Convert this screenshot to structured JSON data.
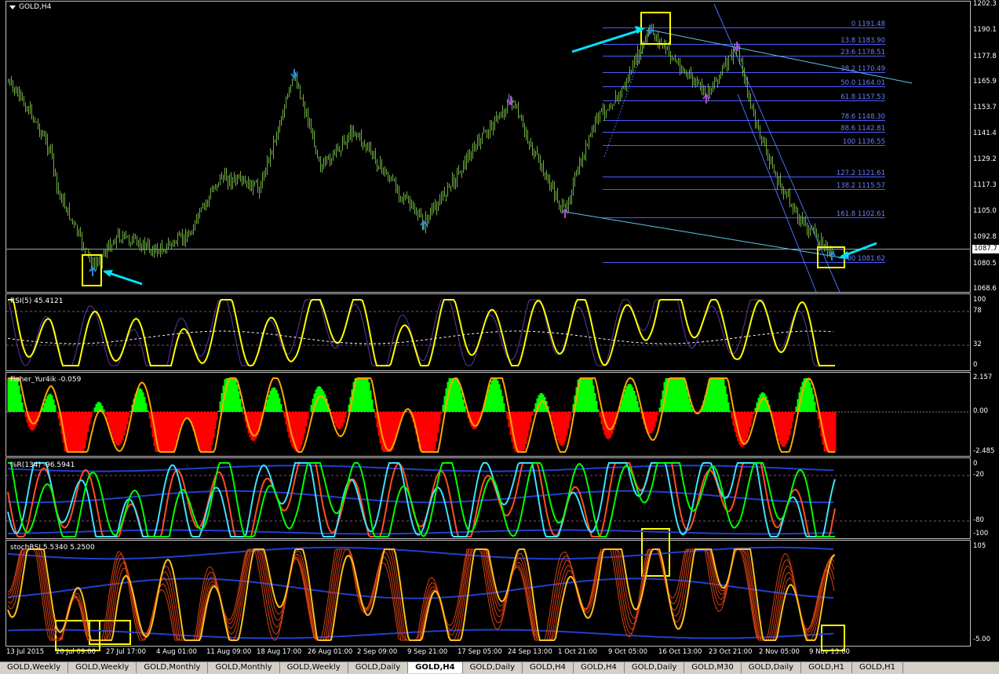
{
  "main_pane": {
    "symbol_label": "GOLD,H4",
    "current_price": "1087.7"
  },
  "price_axis": [
    "1202.3",
    "1190.1",
    "1177.8",
    "1165.9",
    "1153.7",
    "1141.4",
    "1129.2",
    "1117.3",
    "1105.0",
    "1092.8",
    "1080.5",
    "1068.6"
  ],
  "fib_levels": [
    "0 1191.48",
    "13.8 1183.90",
    "23.6 1178.51",
    "38.2 1170.49",
    "50.0 1164.01",
    "61.8 1157.53",
    "78.6 1148.30",
    "88.6 1142.81",
    "100 1136.55",
    "127.2 1121.61",
    "138.2 1115.57",
    "161.8 1102.61",
    "200 1081.62"
  ],
  "indicators": {
    "rsi": {
      "label": "RSI(5) 45.4121",
      "scale": [
        "100",
        "78",
        "32",
        "0"
      ]
    },
    "fisher": {
      "label": "Fisher_Yur4ik -0.059",
      "scale": [
        "2.157",
        "0.00",
        "-2.485"
      ]
    },
    "wpr": {
      "label": "%R(134) -96.5941",
      "scale": [
        "0",
        "-20",
        "-80",
        "-100"
      ]
    },
    "stochrsi": {
      "label": "stochRSI 5.5340 5.2500",
      "scale": [
        "105",
        "-5.00"
      ]
    }
  },
  "date_axis": [
    "13 Jul 2015",
    "20 Jul 09:00",
    "27 Jul 17:00",
    "4 Aug 01:00",
    "11 Aug 09:00",
    "18 Aug 17:00",
    "26 Aug 01:00",
    "2 Sep 09:00",
    "9 Sep 21:00",
    "17 Sep 05:00",
    "24 Sep 13:00",
    "1 Oct 21:00",
    "9 Oct 05:00",
    "16 Oct 13:00",
    "23 Oct 21:00",
    "2 Nov 05:00",
    "9 Nov 13:00"
  ],
  "tabs": [
    "GOLD,Weekly",
    "GOLD,Weekly",
    "GOLD,Monthly",
    "GOLD,Monthly",
    "GOLD,Weekly",
    "GOLD,Daily",
    "GOLD,H4",
    "GOLD,Daily",
    "GOLD,H4",
    "GOLD,H4",
    "GOLD,Daily",
    "GOLD,M30",
    "GOLD,Daily",
    "GOLD,H1",
    "GOLD,H1"
  ],
  "active_tab_index": 6,
  "colors": {
    "background": "#000000",
    "candles": "#6fae3f",
    "fib": "#4a5cff",
    "trend": "#58c8f0",
    "rsi": "#ffff00",
    "fisher_pos": "#00ff00",
    "fisher_neg": "#ff0000",
    "wpr_line": "#00ff00",
    "band": "#2040d0",
    "annotation_box": "#ffff00",
    "annotation_arrow": "#00e5ff"
  },
  "icons": [
    "dropdown-arrow-icon",
    "fractal-down-arrow-icon",
    "fractal-up-arrow-icon"
  ]
}
